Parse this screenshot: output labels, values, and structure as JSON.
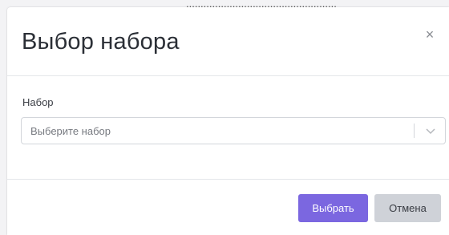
{
  "backdrop": {
    "text": "...................................................."
  },
  "modal": {
    "title": "Выбор набора",
    "close_glyph": "×",
    "field": {
      "label": "Набор",
      "placeholder": "Выберите набор"
    },
    "buttons": {
      "confirm_label": "Выбрать",
      "cancel_label": "Отмена"
    }
  },
  "colors": {
    "primary": "#7b67e0",
    "secondary": "#cfd2d8"
  },
  "icons": {
    "close": "close-icon",
    "dropdown": "chevron-down-icon"
  }
}
